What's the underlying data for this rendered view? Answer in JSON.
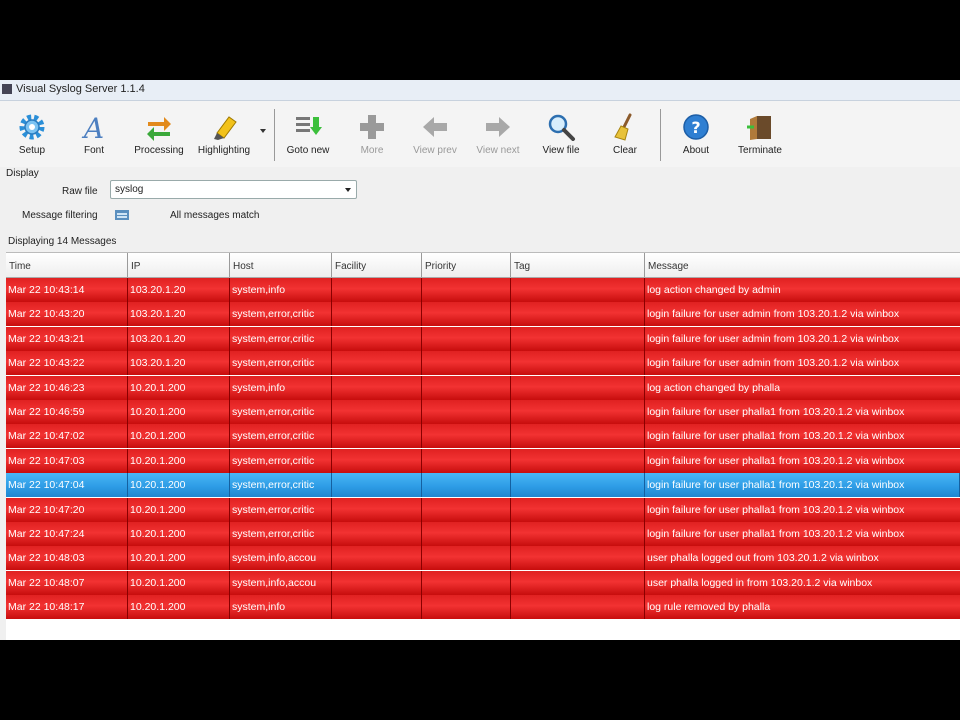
{
  "window": {
    "title": "Visual Syslog Server 1.1.4"
  },
  "toolbar": {
    "setup": "Setup",
    "font": "Font",
    "processing": "Processing",
    "highlighting": "Highlighting",
    "goto_new": "Goto new",
    "more": "More",
    "view_prev": "View prev",
    "view_next": "View next",
    "view_file": "View file",
    "clear": "Clear",
    "about": "About",
    "terminate": "Terminate"
  },
  "display": {
    "legend": "Display",
    "raw_file_label": "Raw file",
    "raw_file_value": "syslog",
    "message_filtering_label": "Message filtering",
    "filter_status": "All messages match"
  },
  "status": {
    "count_text": "Displaying 14 Messages"
  },
  "table": {
    "columns": [
      "Time",
      "IP",
      "Host",
      "Facility",
      "Priority",
      "Tag",
      "Message"
    ],
    "rows": [
      {
        "time": "Mar 22 10:43:14",
        "ip": "103.20.1.20",
        "host": "system,info",
        "facility": "",
        "priority": "",
        "tag": "",
        "message": "log action changed by admin",
        "selected": false
      },
      {
        "time": "Mar 22 10:43:20",
        "ip": "103.20.1.20",
        "host": "system,error,critic",
        "facility": "",
        "priority": "",
        "tag": "",
        "message": "login failure for user admin from 103.20.1.2 via winbox",
        "selected": false
      },
      {
        "time": "Mar 22 10:43:21",
        "ip": "103.20.1.20",
        "host": "system,error,critic",
        "facility": "",
        "priority": "",
        "tag": "",
        "message": "login failure for user admin from 103.20.1.2 via winbox",
        "selected": false
      },
      {
        "time": "Mar 22 10:43:22",
        "ip": "103.20.1.20",
        "host": "system,error,critic",
        "facility": "",
        "priority": "",
        "tag": "",
        "message": "login failure for user admin from 103.20.1.2 via winbox",
        "selected": false
      },
      {
        "time": "Mar 22 10:46:23",
        "ip": "10.20.1.200",
        "host": "system,info",
        "facility": "",
        "priority": "",
        "tag": "",
        "message": "log action changed by phalla",
        "selected": false
      },
      {
        "time": "Mar 22 10:46:59",
        "ip": "10.20.1.200",
        "host": "system,error,critic",
        "facility": "",
        "priority": "",
        "tag": "",
        "message": "login failure for user phalla1 from 103.20.1.2 via winbox",
        "selected": false
      },
      {
        "time": "Mar 22 10:47:02",
        "ip": "10.20.1.200",
        "host": "system,error,critic",
        "facility": "",
        "priority": "",
        "tag": "",
        "message": "login failure for user phalla1 from 103.20.1.2 via winbox",
        "selected": false
      },
      {
        "time": "Mar 22 10:47:03",
        "ip": "10.20.1.200",
        "host": "system,error,critic",
        "facility": "",
        "priority": "",
        "tag": "",
        "message": "login failure for user phalla1 from 103.20.1.2 via winbox",
        "selected": false
      },
      {
        "time": "Mar 22 10:47:04",
        "ip": "10.20.1.200",
        "host": "system,error,critic",
        "facility": "",
        "priority": "",
        "tag": "",
        "message": "login failure for user phalla1 from 103.20.1.2 via winbox",
        "selected": true
      },
      {
        "time": "Mar 22 10:47:20",
        "ip": "10.20.1.200",
        "host": "system,error,critic",
        "facility": "",
        "priority": "",
        "tag": "",
        "message": "login failure for user phalla1 from 103.20.1.2 via winbox",
        "selected": false
      },
      {
        "time": "Mar 22 10:47:24",
        "ip": "10.20.1.200",
        "host": "system,error,critic",
        "facility": "",
        "priority": "",
        "tag": "",
        "message": "login failure for user phalla1 from 103.20.1.2 via winbox",
        "selected": false
      },
      {
        "time": "Mar 22 10:48:03",
        "ip": "10.20.1.200",
        "host": "system,info,accou",
        "facility": "",
        "priority": "",
        "tag": "",
        "message": "user phalla logged out from 103.20.1.2 via winbox",
        "selected": false
      },
      {
        "time": "Mar 22 10:48:07",
        "ip": "10.20.1.200",
        "host": "system,info,accou",
        "facility": "",
        "priority": "",
        "tag": "",
        "message": "user phalla logged in from 103.20.1.2 via winbox",
        "selected": false
      },
      {
        "time": "Mar 22 10:48:17",
        "ip": "10.20.1.200",
        "host": "system,info",
        "facility": "",
        "priority": "",
        "tag": "",
        "message": "log rule removed by phalla",
        "selected": false
      }
    ]
  },
  "colors": {
    "row_error": "#e02121",
    "row_selected": "#2e9de6"
  }
}
